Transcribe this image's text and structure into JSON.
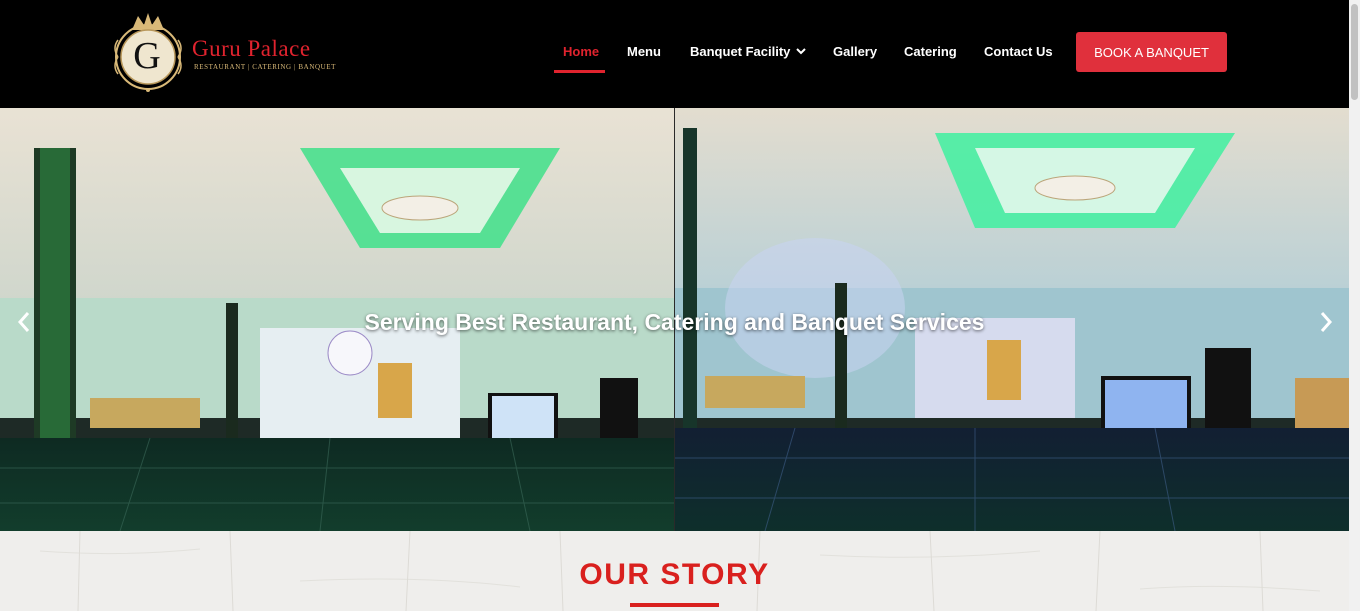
{
  "brand": {
    "name": "Guru Palace",
    "tagline": "RESTAURANT | CATERING | BANQUET",
    "monogram": "G"
  },
  "nav": {
    "items": [
      {
        "label": "Home",
        "active": true
      },
      {
        "label": "Menu"
      },
      {
        "label": "Banquet Facility",
        "has_dropdown": true
      },
      {
        "label": "Gallery"
      },
      {
        "label": "Catering"
      },
      {
        "label": "Contact Us"
      }
    ],
    "cta_label": "BOOK A BANQUET"
  },
  "hero": {
    "caption": "Serving Best Restaurant, Catering and Banquet Services",
    "prev_icon": "chevron-left-icon",
    "next_icon": "chevron-right-icon"
  },
  "story": {
    "title": "OUR STORY"
  },
  "colors": {
    "accent": "#e0232e",
    "header_bg": "#000000",
    "cta_bg": "#e0303c",
    "gold": "#d9b978"
  }
}
